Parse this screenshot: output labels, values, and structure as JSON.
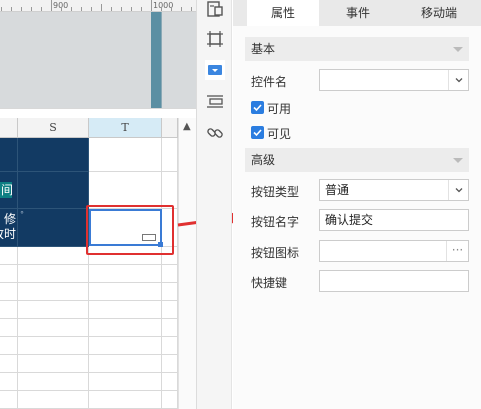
{
  "ruler": {
    "mark_900": "900",
    "mark_1000": "1000"
  },
  "grid": {
    "columns": [
      "S",
      "T"
    ],
    "rows": [
      {
        "left_text": "间"
      },
      {
        "left_text_line1": "修",
        "left_text_line2": "改时",
        "corner_mark": "°"
      }
    ]
  },
  "tabs": [
    "属性",
    "事件",
    "移动端"
  ],
  "sections": {
    "basic": "基本",
    "advanced": "高级"
  },
  "props": {
    "control_name_label": "控件名",
    "control_name_value": "",
    "enabled_label": "可用",
    "visible_label": "可见",
    "button_type_label": "按钮类型",
    "button_type_value": "普通",
    "button_name_label": "按钮名字",
    "button_name_value": "确认提交",
    "button_icon_label": "按钮图标",
    "button_icon_value": "",
    "button_icon_more": "···",
    "shortcut_label": "快捷键",
    "shortcut_value": ""
  },
  "icons": [
    "template-icon",
    "frame-icon",
    "dropdown-widget-icon",
    "layers-icon",
    "link-icon"
  ],
  "colors": {
    "accent": "#2b7de0",
    "dark_cell": "#123a63",
    "highlight_red": "#e03030",
    "teal": "#0d7f83"
  }
}
